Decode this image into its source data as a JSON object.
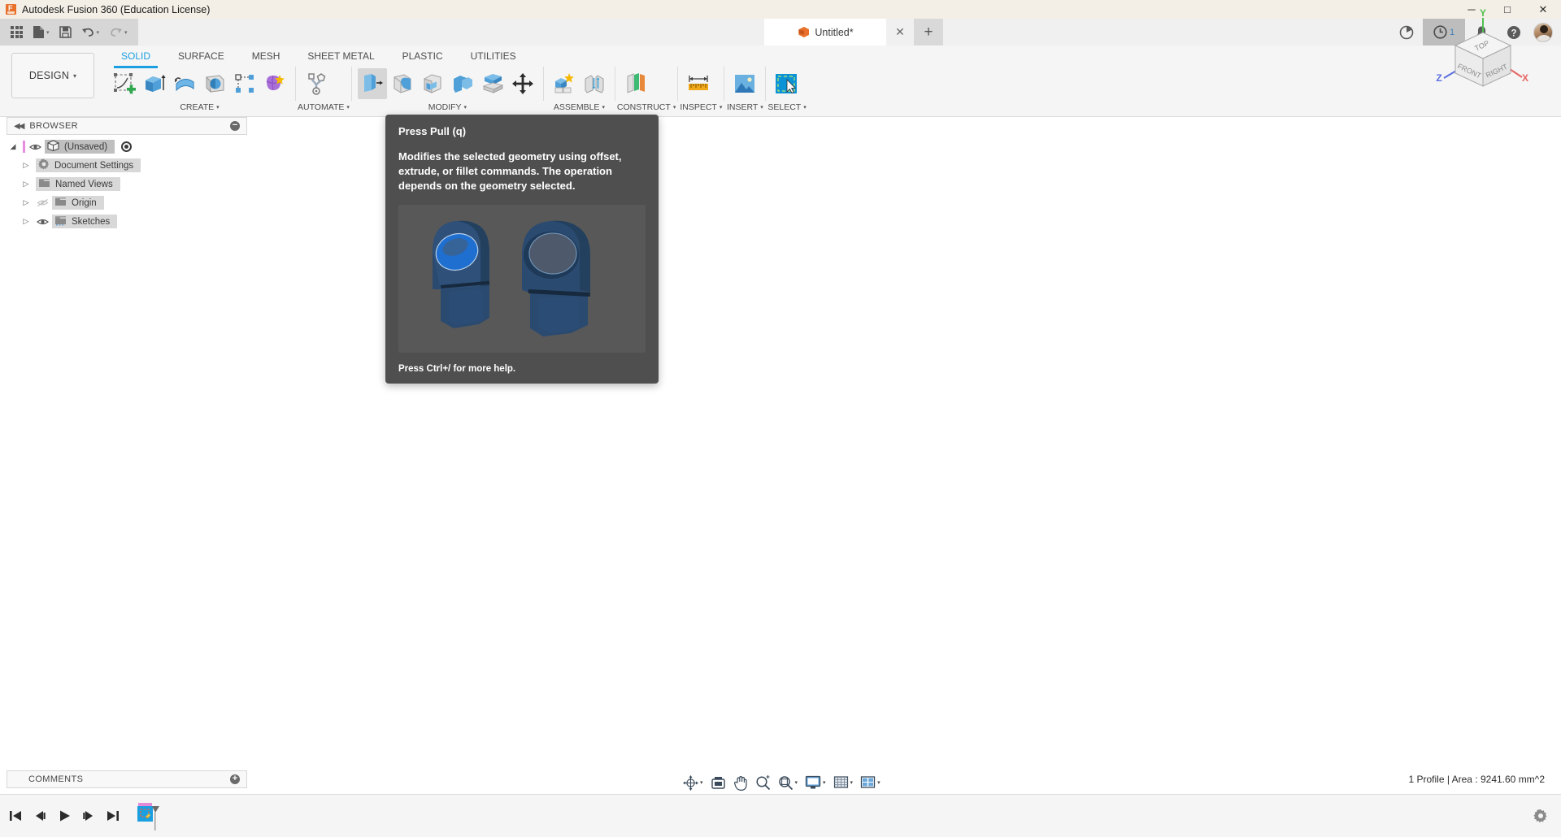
{
  "window": {
    "app_title": "Autodesk Fusion 360 (Education License)",
    "app_icon": "fusion-logo-icon",
    "minimize": "─",
    "maximize": "□",
    "close": "✕"
  },
  "appbar": {
    "grid_icon": "app-grid-icon",
    "new_doc_icon": "new-document-icon",
    "save_icon": "save-icon",
    "undo_icon": "undo-arrow-icon",
    "redo_icon": "redo-arrow-icon",
    "caret": "▾",
    "document_tab": {
      "label": "Untitled*",
      "icon": "orange-cube-icon",
      "close": "✕"
    },
    "add_tab": "+",
    "right_icons": [
      {
        "name": "extensions-icon",
        "glyph": "◔"
      },
      {
        "name": "job-status-icon",
        "glyph": "◷",
        "badge": "1"
      },
      {
        "name": "notifications-bell-icon",
        "glyph": "🔔"
      },
      {
        "name": "help-icon",
        "glyph": "?"
      }
    ],
    "avatar": "user-avatar"
  },
  "ribbon": {
    "workspace": {
      "label": "DESIGN",
      "caret": "▾"
    },
    "tabs": [
      {
        "label": "SOLID",
        "active": true
      },
      {
        "label": "SURFACE",
        "active": false
      },
      {
        "label": "MESH",
        "active": false
      },
      {
        "label": "SHEET METAL",
        "active": false
      },
      {
        "label": "PLASTIC",
        "active": false
      },
      {
        "label": "UTILITIES",
        "active": false
      }
    ],
    "panels": [
      {
        "title": "CREATE",
        "caret": "▾",
        "tools": [
          {
            "name": "create-sketch-icon"
          },
          {
            "name": "extrude-icon"
          },
          {
            "name": "revolve-icon"
          },
          {
            "name": "sweep-icon"
          },
          {
            "name": "pattern-icon"
          },
          {
            "name": "create-form-icon"
          }
        ]
      },
      {
        "title": "AUTOMATE",
        "caret": "▾",
        "tools": [
          {
            "name": "automate-topology-icon"
          }
        ]
      },
      {
        "title": "MODIFY",
        "caret": "▾",
        "tools": [
          {
            "name": "press-pull-icon",
            "active": true
          },
          {
            "name": "fillet-icon"
          },
          {
            "name": "shell-icon"
          },
          {
            "name": "combine-icon"
          },
          {
            "name": "split-face-icon"
          },
          {
            "name": "move-copy-icon"
          }
        ]
      },
      {
        "title": "ASSEMBLE",
        "caret": "▾",
        "tools": [
          {
            "name": "new-component-icon"
          },
          {
            "name": "joint-icon"
          }
        ]
      },
      {
        "title": "CONSTRUCT",
        "caret": "▾",
        "tools": [
          {
            "name": "offset-plane-icon"
          }
        ]
      },
      {
        "title": "INSPECT",
        "caret": "▾",
        "tools": [
          {
            "name": "measure-ruler-icon"
          }
        ]
      },
      {
        "title": "INSERT",
        "caret": "▾",
        "tools": [
          {
            "name": "insert-image-icon"
          }
        ]
      },
      {
        "title": "SELECT",
        "caret": "▾",
        "tools": [
          {
            "name": "select-cursor-icon"
          }
        ]
      }
    ]
  },
  "browser": {
    "header": {
      "collapse": "◀◀",
      "title": "BROWSER",
      "minimize": "−"
    },
    "nodes": [
      {
        "label": "(Unsaved)",
        "arrow": "◢",
        "icon": "component-cube-icon",
        "visible": true,
        "has_activate_radio": true,
        "indent": 0,
        "chip": "dark"
      },
      {
        "label": "Document Settings",
        "arrow": "▷",
        "icon": "gear-icon",
        "indent": 1,
        "chip": "light"
      },
      {
        "label": "Named Views",
        "arrow": "▷",
        "icon": "folder-icon",
        "indent": 1,
        "chip": "light"
      },
      {
        "label": "Origin",
        "arrow": "▷",
        "icon": "folder-icon",
        "visible": false,
        "indent": 1,
        "chip": "light"
      },
      {
        "label": "Sketches",
        "arrow": "▷",
        "icon": "folder-sketch-icon",
        "visible": true,
        "indent": 1,
        "chip": "light"
      }
    ]
  },
  "tooltip": {
    "title": "Press Pull (q)",
    "body": "Modifies the selected geometry using offset, extrude, or fillet commands. The operation depends on the geometry selected.",
    "image_alt": "press-pull-example-render",
    "footer": "Press Ctrl+/ for more help."
  },
  "viewcube": {
    "faces": {
      "top": "TOP",
      "front": "FRONT",
      "right": "RIGHT"
    },
    "axes": {
      "x": "X",
      "y": "Y",
      "z": "Z"
    },
    "axis_colors": {
      "x": "#e86464",
      "y": "#4fbf4f",
      "z": "#5a6fe0"
    }
  },
  "comments": {
    "title": "COMMENTS",
    "add": "+"
  },
  "nav_toolbar": [
    {
      "name": "orbit-icon",
      "caret": "▾"
    },
    {
      "name": "look-at-icon",
      "caret": ""
    },
    {
      "name": "pan-hand-icon",
      "caret": ""
    },
    {
      "name": "zoom-icon",
      "caret": ""
    },
    {
      "name": "fit-icon",
      "caret": "▾"
    },
    {
      "name": "display-settings-icon",
      "caret": "▾"
    },
    {
      "name": "grid-snaps-icon",
      "caret": "▾"
    },
    {
      "name": "viewports-icon",
      "caret": "▾"
    }
  ],
  "status": {
    "text": "1 Profile | Area : 9241.60 mm^2"
  },
  "timeline": {
    "controls": [
      {
        "name": "jump-to-beginning-icon",
        "glyph": "⏮"
      },
      {
        "name": "step-back-icon",
        "glyph": "◀"
      },
      {
        "name": "play-icon",
        "glyph": "▶"
      },
      {
        "name": "step-forward-icon",
        "glyph": "▶"
      },
      {
        "name": "jump-to-end-icon",
        "glyph": "⏭"
      }
    ],
    "feature": {
      "name": "sketch-feature-node",
      "label": ""
    },
    "settings_icon": "timeline-settings-gear-icon"
  },
  "canvas": {
    "sketch_profile": {
      "fill": "#64b5e8",
      "stroke": "#1669a8",
      "opacity": 0.55,
      "center_point": "sketch-origin-point"
    },
    "grid_color": "#e6e6e6",
    "x_axis_color": "#e8a0a0",
    "z_axis_color": "#9a9ae0"
  },
  "colors": {
    "accent": "#1a9fe0",
    "ribbon_bg": "#f5f5f5",
    "titlebar_bg": "#f3efe6",
    "tooltip_bg": "#4f4f4f",
    "brand_orange": "#e8702a"
  }
}
